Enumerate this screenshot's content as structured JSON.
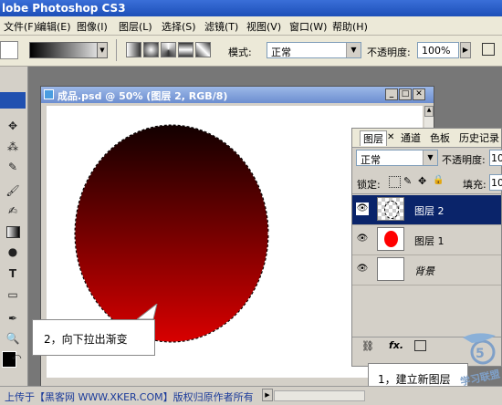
{
  "app": {
    "title": "lobe Photoshop CS3"
  },
  "menu": [
    "文件(F)",
    "编辑(E)",
    "图像(I)",
    "图层(L)",
    "选择(S)",
    "滤镜(T)",
    "视图(V)",
    "窗口(W)",
    "帮助(H)"
  ],
  "options": {
    "mode_label": "模式:",
    "mode_value": "正常",
    "opacity_label": "不透明度:",
    "opacity_value": "100%"
  },
  "document": {
    "title": "成品.psd @ 50% (图层 2, RGB/8)"
  },
  "layers_panel": {
    "tabs": [
      "图层",
      "通道",
      "色板",
      "历史记录"
    ],
    "blend_mode": "正常",
    "opacity_label": "不透明度:",
    "opacity_value": "10",
    "lock_label": "锁定:",
    "fill_label": "填充:",
    "fill_value": "10",
    "layers": [
      {
        "name": "图层 2",
        "selected": true
      },
      {
        "name": "图层 1",
        "selected": false
      },
      {
        "name": "背景",
        "selected": false
      }
    ],
    "fx_label": "fx."
  },
  "callouts": {
    "step2": "2，向下拉出渐变",
    "step1": "1，建立新图层"
  },
  "status": {
    "text": "上传于【黑客网 WWW.XKER.COM】版权归原作者所有"
  },
  "watermark": {
    "text": "学习联盟"
  },
  "colors": {
    "gradient_top": "#120000",
    "gradient_bottom": "#d80000",
    "selected_layer": "#0a246a",
    "layer1_red": "#ff0000"
  }
}
